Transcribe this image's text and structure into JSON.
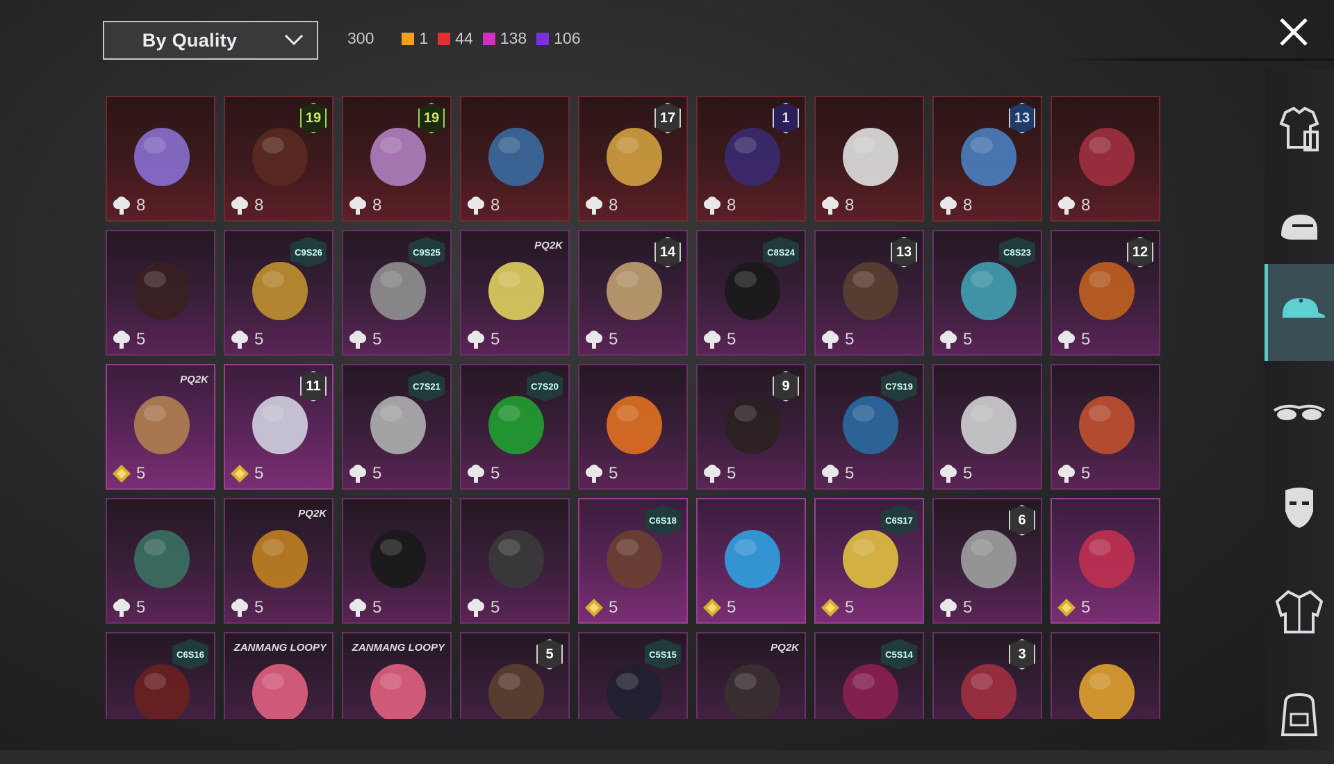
{
  "filter": {
    "label": "By Quality",
    "total": "300"
  },
  "quality_counts": [
    {
      "color": "#f0a020",
      "count": "1"
    },
    {
      "color": "#e03030",
      "count": "44"
    },
    {
      "color": "#d030c0",
      "count": "138"
    },
    {
      "color": "#7a30e0",
      "count": "106"
    }
  ],
  "sidebar": {
    "tabs": [
      {
        "icon": "outfit-icon"
      },
      {
        "icon": "helmet-icon"
      },
      {
        "icon": "headwear-icon",
        "active": true
      },
      {
        "icon": "glasses-icon"
      },
      {
        "icon": "mask-icon"
      },
      {
        "icon": "jacket-icon"
      },
      {
        "icon": "backpack-icon"
      }
    ]
  },
  "items": [
    {
      "quality": "red",
      "cost": "8",
      "currency": "cloud",
      "badge": "",
      "art": "#8a6fd0"
    },
    {
      "quality": "red",
      "cost": "8",
      "currency": "cloud",
      "badge": "19",
      "badge_style": "green",
      "art": "#5a2a20"
    },
    {
      "quality": "red",
      "cost": "8",
      "currency": "cloud",
      "badge": "19",
      "badge_style": "green",
      "art": "#b080c0"
    },
    {
      "quality": "red",
      "cost": "8",
      "currency": "cloud",
      "badge": "",
      "art": "#3a6aa0"
    },
    {
      "quality": "red",
      "cost": "8",
      "currency": "cloud",
      "badge": "17",
      "badge_style": "lvl",
      "art": "#d0a040"
    },
    {
      "quality": "red",
      "cost": "8",
      "currency": "cloud",
      "badge": "1",
      "badge_style": "purple",
      "art": "#3a2a70"
    },
    {
      "quality": "red",
      "cost": "8",
      "currency": "cloud",
      "badge": "",
      "art": "#e0e0e0"
    },
    {
      "quality": "red",
      "cost": "8",
      "currency": "cloud",
      "badge": "13",
      "badge_style": "blue",
      "art": "#4a80c0"
    },
    {
      "quality": "red",
      "cost": "8",
      "currency": "cloud",
      "badge": "",
      "art": "#a03040"
    },
    {
      "quality": "purple",
      "cost": "5",
      "currency": "cloud",
      "badge": "",
      "art": "#3a2020"
    },
    {
      "quality": "purple",
      "cost": "5",
      "currency": "cloud",
      "badge": "C9S26",
      "badge_style": "ssn",
      "art": "#c09030"
    },
    {
      "quality": "purple",
      "cost": "5",
      "currency": "cloud",
      "badge": "C9S25",
      "badge_style": "ssn",
      "art": "#909090"
    },
    {
      "quality": "purple",
      "cost": "5",
      "currency": "cloud",
      "badge": "PQ2K",
      "badge_style": "txt",
      "art": "#e0d060"
    },
    {
      "quality": "purple",
      "cost": "5",
      "currency": "cloud",
      "badge": "14",
      "badge_style": "lvl",
      "art": "#c0a070"
    },
    {
      "quality": "purple",
      "cost": "5",
      "currency": "cloud",
      "badge": "C8S24",
      "badge_style": "ssn",
      "art": "#1a1a1a"
    },
    {
      "quality": "purple",
      "cost": "5",
      "currency": "cloud",
      "badge": "13",
      "badge_style": "lvl",
      "art": "#5a4030"
    },
    {
      "quality": "purple",
      "cost": "5",
      "currency": "cloud",
      "badge": "C8S23",
      "badge_style": "ssn",
      "art": "#40a0b0"
    },
    {
      "quality": "purple",
      "cost": "5",
      "currency": "cloud",
      "badge": "12",
      "badge_style": "lvl",
      "art": "#c06020"
    },
    {
      "quality": "purple hi",
      "cost": "5",
      "currency": "gem",
      "badge": "PQ2K",
      "badge_style": "txt",
      "art": "#b08050"
    },
    {
      "quality": "purple hi",
      "cost": "5",
      "currency": "gem",
      "badge": "11",
      "badge_style": "lvl",
      "art": "#d0d0e0"
    },
    {
      "quality": "purple",
      "cost": "5",
      "currency": "cloud",
      "badge": "C7S21",
      "badge_style": "ssn",
      "art": "#b0b0b0"
    },
    {
      "quality": "purple",
      "cost": "5",
      "currency": "cloud",
      "badge": "C7S20",
      "badge_style": "ssn",
      "art": "#20a030"
    },
    {
      "quality": "purple",
      "cost": "5",
      "currency": "cloud",
      "badge": "",
      "art": "#e07020"
    },
    {
      "quality": "purple",
      "cost": "5",
      "currency": "cloud",
      "badge": "9",
      "badge_style": "lvl",
      "art": "#2a2020"
    },
    {
      "quality": "purple",
      "cost": "5",
      "currency": "cloud",
      "badge": "C7S19",
      "badge_style": "ssn",
      "art": "#2a6aa0"
    },
    {
      "quality": "purple",
      "cost": "5",
      "currency": "cloud",
      "badge": "",
      "art": "#d0d0d0"
    },
    {
      "quality": "purple",
      "cost": "5",
      "currency": "cloud",
      "badge": "",
      "art": "#c05030"
    },
    {
      "quality": "purple",
      "cost": "5",
      "currency": "cloud",
      "badge": "",
      "art": "#3a7060"
    },
    {
      "quality": "purple",
      "cost": "5",
      "currency": "cloud",
      "badge": "PQ2K",
      "badge_style": "txt",
      "art": "#c08020"
    },
    {
      "quality": "purple",
      "cost": "5",
      "currency": "cloud",
      "badge": "",
      "art": "#1a1a1a"
    },
    {
      "quality": "purple",
      "cost": "5",
      "currency": "cloud",
      "badge": "",
      "art": "#3a3a3a"
    },
    {
      "quality": "purple hi",
      "cost": "5",
      "currency": "gem",
      "badge": "C6S18",
      "badge_style": "ssn",
      "art": "#6a4030"
    },
    {
      "quality": "purple hi",
      "cost": "5",
      "currency": "gem",
      "badge": "",
      "art": "#30a0e0"
    },
    {
      "quality": "purple hi",
      "cost": "5",
      "currency": "gem",
      "badge": "C6S17",
      "badge_style": "ssn",
      "art": "#e0c040"
    },
    {
      "quality": "purple",
      "cost": "5",
      "currency": "cloud",
      "badge": "6",
      "badge_style": "lvl",
      "art": "#a0a0a0"
    },
    {
      "quality": "purple hi",
      "cost": "5",
      "currency": "gem",
      "badge": "",
      "art": "#c03050"
    },
    {
      "quality": "purple",
      "cost": "",
      "currency": "",
      "badge": "C6S16",
      "badge_style": "ssn",
      "art": "#6a2020"
    },
    {
      "quality": "purple",
      "cost": "",
      "currency": "",
      "badge": "ZANMANG LOOPY",
      "badge_style": "txt",
      "art": "#e06080"
    },
    {
      "quality": "purple",
      "cost": "",
      "currency": "",
      "badge": "ZANMANG LOOPY",
      "badge_style": "txt",
      "art": "#e06080"
    },
    {
      "quality": "purple",
      "cost": "",
      "currency": "",
      "badge": "5",
      "badge_style": "lvl",
      "art": "#5a4030"
    },
    {
      "quality": "purple",
      "cost": "",
      "currency": "",
      "badge": "C5S15",
      "badge_style": "ssn",
      "art": "#202030"
    },
    {
      "quality": "purple",
      "cost": "",
      "currency": "",
      "badge": "PQ2K",
      "badge_style": "txt",
      "art": "#3a3030"
    },
    {
      "quality": "purple",
      "cost": "",
      "currency": "",
      "badge": "C5S14",
      "badge_style": "ssn",
      "art": "#8a2050"
    },
    {
      "quality": "purple",
      "cost": "",
      "currency": "",
      "badge": "3",
      "badge_style": "lvl",
      "art": "#a03040"
    },
    {
      "quality": "purple",
      "cost": "",
      "currency": "",
      "badge": "",
      "art": "#e0a030"
    }
  ]
}
